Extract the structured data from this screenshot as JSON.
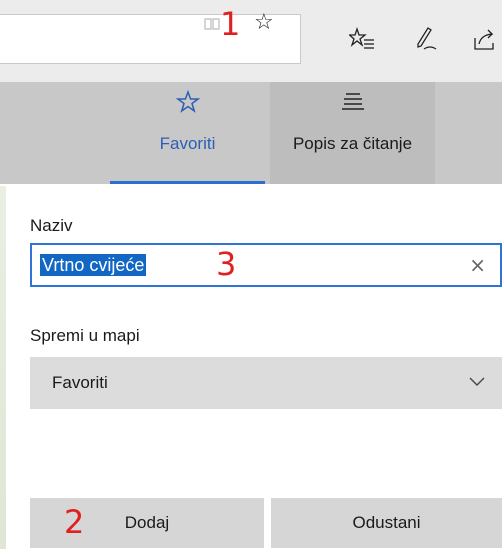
{
  "toolbar": {
    "annotation_1": "1",
    "favorite_star": "☆",
    "icons": [
      "favorites-list-icon",
      "web-note-pen-icon",
      "share-icon"
    ]
  },
  "tabs": [
    {
      "label": "Favoriti",
      "icon": "star-icon",
      "selected": true
    },
    {
      "label": "Popis za čitanje",
      "icon": "reading-list-icon",
      "selected": false
    }
  ],
  "form": {
    "name_label": "Naziv",
    "name_value": "Vrtno cvijeće",
    "annotation_3": "3",
    "clear_glyph": "×",
    "folder_label": "Spremi u mapi",
    "folder_value": "Favoriti"
  },
  "buttons": {
    "annotation_2": "2",
    "add_label": "Dodaj",
    "cancel_label": "Odustani"
  },
  "colors": {
    "accent": "#2b6fd0",
    "selection": "#1266c4",
    "annotation": "#e02020"
  }
}
